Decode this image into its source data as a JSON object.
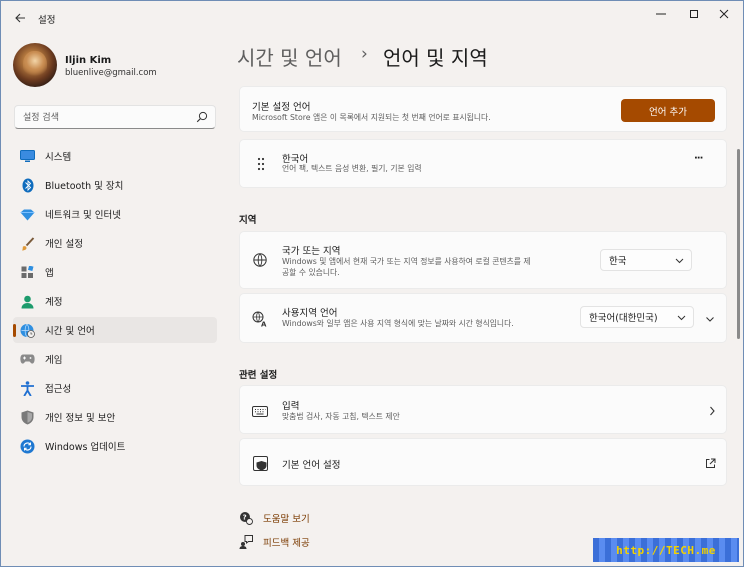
{
  "window": {
    "title": "설정",
    "controls": {
      "minimize": "—",
      "maximize": "",
      "close": "✕"
    }
  },
  "profile": {
    "name": "Iljin Kim",
    "email": "bluenlive@gmail.com"
  },
  "search": {
    "placeholder": "설정 검색"
  },
  "sidebar": {
    "items": [
      {
        "label": "시스템",
        "icon": "monitor-icon",
        "color": "#0f6cbd"
      },
      {
        "label": "Bluetooth 및 장치",
        "icon": "bluetooth-icon",
        "color": "#0f6cbd"
      },
      {
        "label": "네트워크 및 인터넷",
        "icon": "wifi-diamond-icon",
        "color": "#2f8fe0"
      },
      {
        "label": "개인 설정",
        "icon": "brush-icon",
        "color": "#c27a2c"
      },
      {
        "label": "앱",
        "icon": "apps-icon",
        "color": "#5a5a5a"
      },
      {
        "label": "계정",
        "icon": "person-icon",
        "color": "#1d9b6c"
      },
      {
        "label": "시간 및 언어",
        "icon": "globe-clock-icon",
        "color": "#2f8fe0"
      },
      {
        "label": "게임",
        "icon": "gamepad-icon",
        "color": "#7a7a7a"
      },
      {
        "label": "접근성",
        "icon": "accessibility-icon",
        "color": "#1f6fd1"
      },
      {
        "label": "개인 정보 및 보안",
        "icon": "shield-icon",
        "color": "#6b6b6b"
      },
      {
        "label": "Windows 업데이트",
        "icon": "update-icon",
        "color": "#1f78d1"
      }
    ],
    "active_index": 6
  },
  "header": {
    "parent": "시간 및 언어",
    "separator": "›",
    "current": "언어 및 지역"
  },
  "preferred_language": {
    "title": "기본 설정 언어",
    "desc": "Microsoft Store 앱은 이 목록에서 지원되는 첫 번째 언어로 표시됩니다.",
    "add_button": "언어 추가"
  },
  "language_item": {
    "title": "한국어",
    "desc": "언어 팩, 텍스트 음성 변환, 필기, 기본 입력",
    "more": "···"
  },
  "region": {
    "section_title": "지역",
    "country": {
      "title": "국가 또는 지역",
      "desc_line1": "Windows 및 앱에서 현재 국가 또는 지역 정보를 사용하여 로컬 콘텐츠를 제",
      "desc_line2": "공할 수 있습니다.",
      "value": "한국"
    },
    "format": {
      "title": "사용지역 언어",
      "desc": "Windows와 일부 앱은 사용 지역 형식에 맞는 날짜와 시간 형식입니다.",
      "value": "한국어(대한민국)"
    }
  },
  "related": {
    "section_title": "관련 설정",
    "typing": {
      "title": "입력",
      "desc": "맞춤법 검사, 자동 고침, 텍스트 제안"
    },
    "admin_language": {
      "title": "기본 언어 설정"
    }
  },
  "links": {
    "help": "도움말 보기",
    "feedback": "피드백 제공"
  },
  "watermark": {
    "text": "http://TECH.me"
  },
  "colors": {
    "accent": "#a54a00",
    "background": "#f4f1ef",
    "card": "#fbfbfb"
  }
}
